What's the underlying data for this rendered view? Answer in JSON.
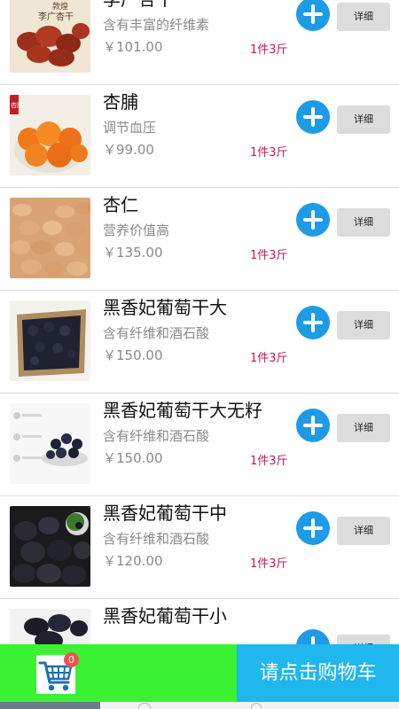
{
  "products": [
    {
      "name": "李广杏干",
      "desc": "含有丰富的纤维素",
      "price": "￥101.00",
      "unit": "1件3斤",
      "detail_label": "详细",
      "image_text": [
        "敦煌",
        "李广杏干"
      ]
    },
    {
      "name": "杏脯",
      "desc": "调节血压",
      "price": "￥99.00",
      "unit": "1件3斤",
      "detail_label": "详细",
      "image_text": [
        "杏脯"
      ]
    },
    {
      "name": "杏仁",
      "desc": "营养价值高",
      "price": "￥135.00",
      "unit": "1件3斤",
      "detail_label": "详细"
    },
    {
      "name": "黑香妃葡萄干大",
      "desc": "含有纤维和酒石酸",
      "price": "￥150.00",
      "unit": "1件3斤",
      "detail_label": "详细"
    },
    {
      "name": "黑香妃葡萄干大无籽",
      "desc": "含有纤维和酒石酸",
      "price": "￥150.00",
      "unit": "1件3斤",
      "detail_label": "详细"
    },
    {
      "name": "黑香妃葡萄干中",
      "desc": "含有纤维和酒石酸",
      "price": "￥120.00",
      "unit": "1件3斤",
      "detail_label": "详细"
    },
    {
      "name": "黑香妃葡萄干小",
      "desc": "",
      "price": "",
      "unit": "",
      "detail_label": "详细"
    }
  ],
  "cart": {
    "badge_count": "0",
    "checkout_label": "请点击购物车"
  },
  "colors": {
    "add_button": "#1e9be6",
    "unit_text": "#c2185b",
    "cart_bar_green": "#3bf232",
    "checkout_blue": "#20b6ee"
  }
}
